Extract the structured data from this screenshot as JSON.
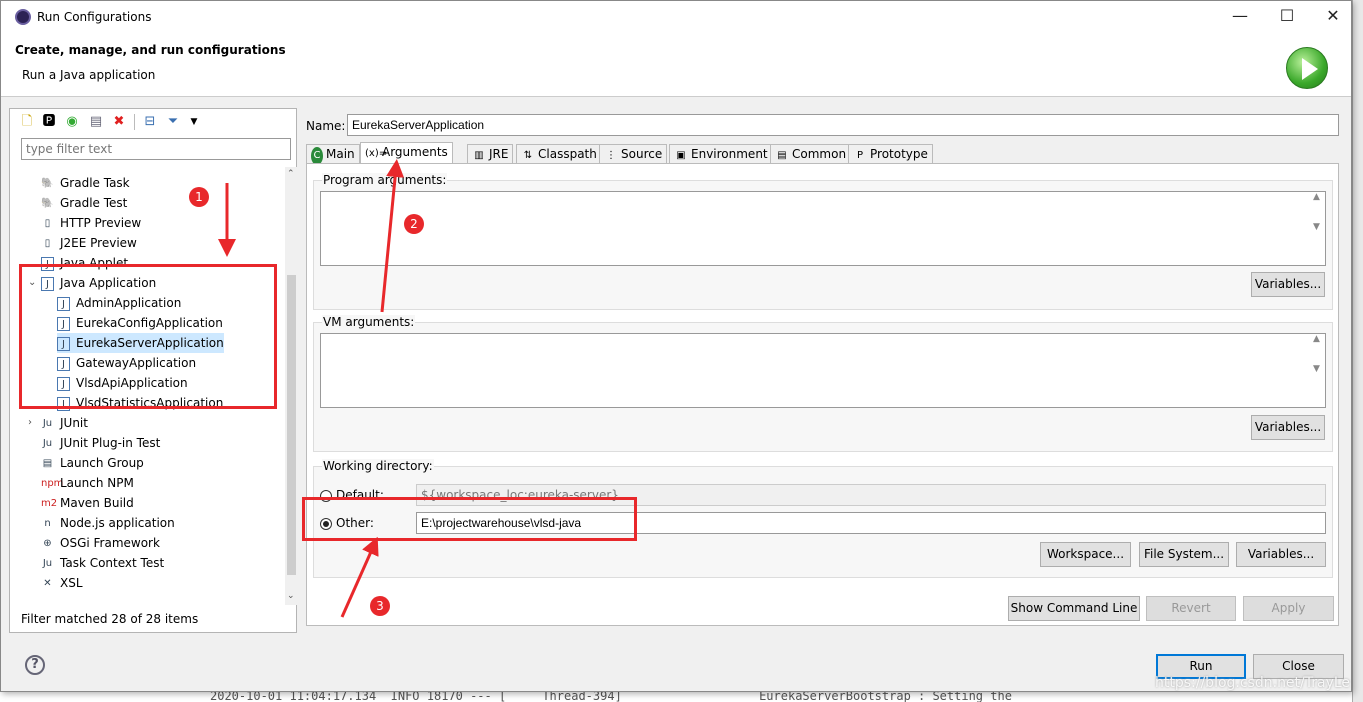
{
  "window": {
    "title": "Run Configurations",
    "minimize": "—",
    "maximize": "☐",
    "close": "✕"
  },
  "header": {
    "title": "Create, manage, and run configurations",
    "subtitle": "Run a Java application"
  },
  "left": {
    "filter_placeholder": "type filter text",
    "toolbar": [
      "new-config-icon",
      "new-prototype-icon",
      "duplicate-icon",
      "export-icon",
      "delete-icon",
      "collapse-all-icon",
      "filter-icon",
      "menu-dropdown-icon"
    ],
    "tree": [
      {
        "label": "Gradle Task",
        "icon": "🐘",
        "level": 1
      },
      {
        "label": "Gradle Test",
        "icon": "🐘",
        "level": 1
      },
      {
        "label": "HTTP Preview",
        "icon": "▯",
        "level": 1
      },
      {
        "label": "J2EE Preview",
        "icon": "▯",
        "level": 1
      },
      {
        "label": "Java Applet",
        "icon": "J",
        "level": 1
      },
      {
        "label": "Java Application",
        "icon": "J",
        "level": 1,
        "expanded": true
      },
      {
        "label": "AdminApplication",
        "icon": "J",
        "level": 2
      },
      {
        "label": "EurekaConfigApplication",
        "icon": "J",
        "level": 2
      },
      {
        "label": "EurekaServerApplication",
        "icon": "J",
        "level": 2,
        "selected": true
      },
      {
        "label": "GatewayApplication",
        "icon": "J",
        "level": 2
      },
      {
        "label": "VlsdApiApplication",
        "icon": "J",
        "level": 2
      },
      {
        "label": "VlsdStatisticsApplication",
        "icon": "J",
        "level": 2
      },
      {
        "label": "JUnit",
        "icon": "Ju",
        "level": 1,
        "collapsed": true
      },
      {
        "label": "JUnit Plug-in Test",
        "icon": "Ju",
        "level": 1
      },
      {
        "label": "Launch Group",
        "icon": "▤",
        "level": 1
      },
      {
        "label": "Launch NPM",
        "icon": "npm",
        "level": 1
      },
      {
        "label": "Maven Build",
        "icon": "m2",
        "level": 1
      },
      {
        "label": "Node.js application",
        "icon": "n",
        "level": 1
      },
      {
        "label": "OSGi Framework",
        "icon": "⊕",
        "level": 1
      },
      {
        "label": "Task Context Test",
        "icon": "Ju",
        "level": 1
      },
      {
        "label": "XSL",
        "icon": "✕",
        "level": 1
      }
    ],
    "filter_message": "Filter matched 28 of 28 items"
  },
  "right": {
    "name_label": "Name:",
    "name_value": "EurekaServerApplication",
    "tabs": [
      {
        "label": "Main",
        "icon": "C"
      },
      {
        "label": "Arguments",
        "icon": "(x)="
      },
      {
        "label": "JRE",
        "icon": "▥"
      },
      {
        "label": "Classpath",
        "icon": "⇅"
      },
      {
        "label": "Source",
        "icon": "⋮"
      },
      {
        "label": "Environment",
        "icon": "▣"
      },
      {
        "label": "Common",
        "icon": "▤"
      },
      {
        "label": "Prototype",
        "icon": "P"
      }
    ],
    "program_args_label": "Program arguments:",
    "program_args_value": "",
    "vm_args_label": "VM arguments:",
    "vm_args_value": "",
    "variables": "Variables...",
    "working_dir_label": "Working directory:",
    "default_label": "Default:",
    "default_value": "${workspace_loc:eureka-server}",
    "other_label": "Other:",
    "other_value": "E:\\projectwarehouse\\vlsd-java",
    "workspace": "Workspace...",
    "file_system": "File System...",
    "show_cmd": "Show Command Line",
    "revert": "Revert",
    "apply": "Apply"
  },
  "footer": {
    "run": "Run",
    "close": "Close",
    "help": "?"
  },
  "annotations": {
    "n1": "1",
    "n2": "2",
    "n3": "3",
    "color": "#e8282b"
  },
  "background": {
    "console": "2020-10-01 11:04:17.134  INFO 18170 --- [     Thread-394]                   EurekaServerBootstrap : Setting the",
    "watermark": "https://blog.csdn.net/TrayLe"
  }
}
